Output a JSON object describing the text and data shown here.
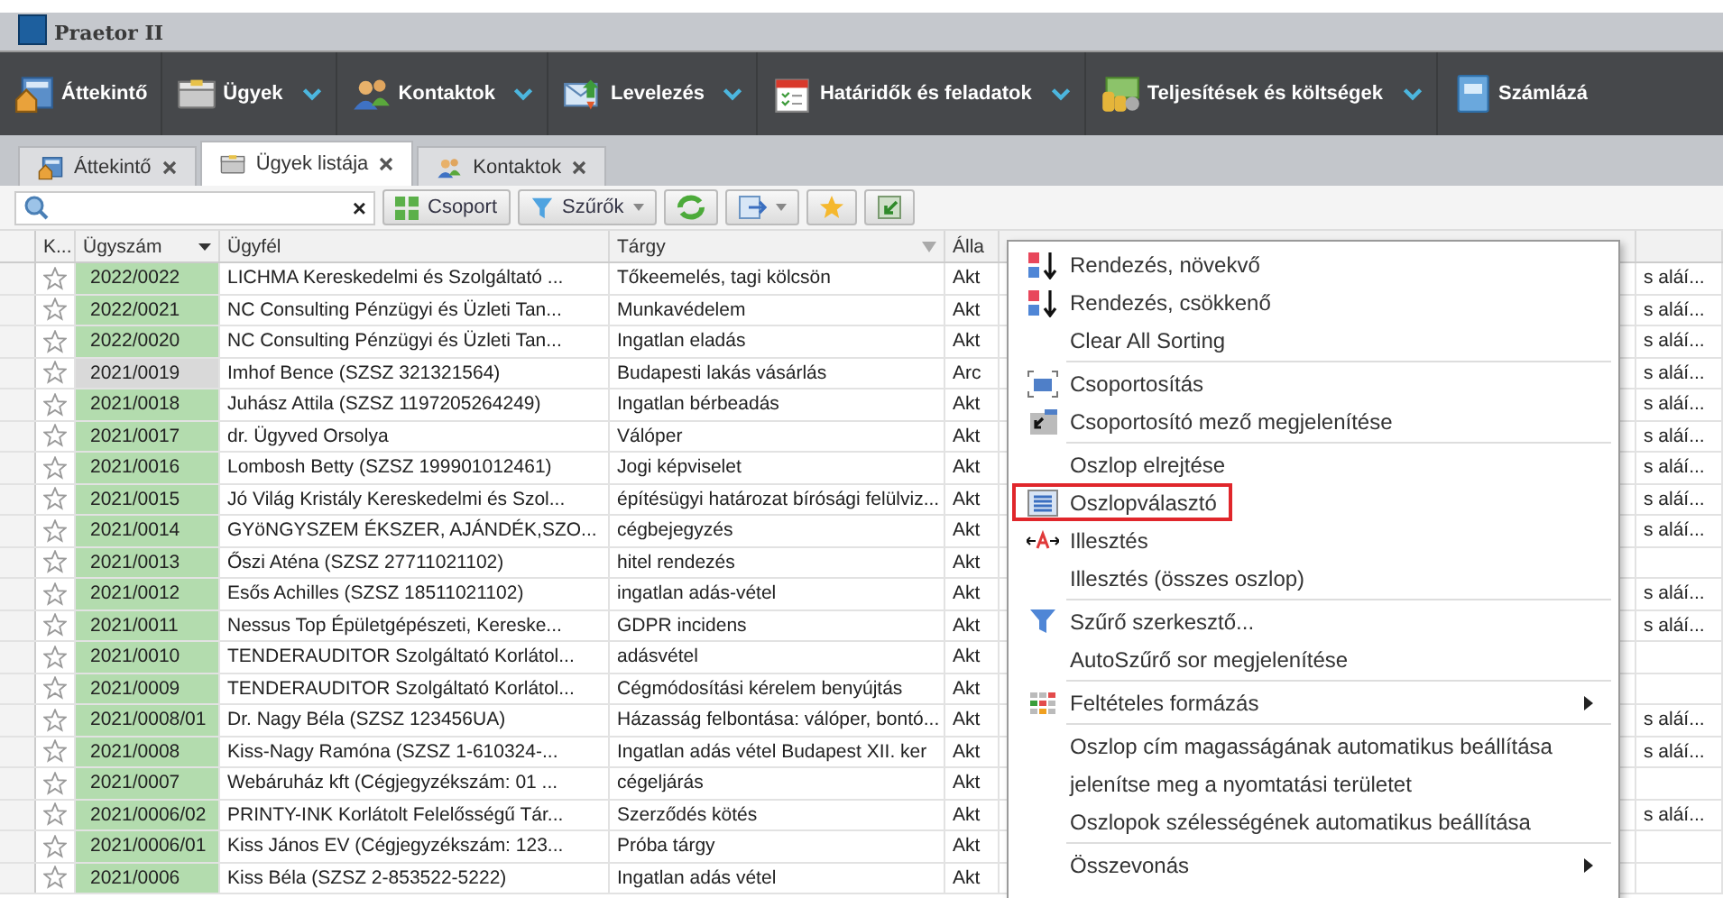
{
  "window": {
    "title": "Praetor II"
  },
  "nav": [
    {
      "label": "Áttekintő",
      "dropdown": false
    },
    {
      "label": "Ügyek",
      "dropdown": true
    },
    {
      "label": "Kontaktok",
      "dropdown": true
    },
    {
      "label": "Levelezés",
      "dropdown": true
    },
    {
      "label": "Határidők és feladatok",
      "dropdown": true
    },
    {
      "label": "Teljesítések és költségek",
      "dropdown": true
    },
    {
      "label": "Számlázá",
      "dropdown": false
    }
  ],
  "tabs": [
    {
      "label": "Áttekintő",
      "selected": false
    },
    {
      "label": "Ügyek listája",
      "selected": true
    },
    {
      "label": "Kontaktok",
      "selected": false
    }
  ],
  "toolbar": {
    "clear": "×",
    "group_button": "Csoport",
    "filter_button": "Szűrők"
  },
  "table": {
    "columns": [
      {
        "label": "K...",
        "sort": false,
        "filter": false
      },
      {
        "label": "Ügyszám",
        "sort": true,
        "filter": false
      },
      {
        "label": "Ügyfél",
        "sort": false,
        "filter": false
      },
      {
        "label": "Tárgy",
        "sort": false,
        "filter": true
      },
      {
        "label": "Álla",
        "sort": false,
        "filter": false
      }
    ],
    "rows": [
      {
        "starred": false,
        "color": "#b3dcae",
        "number": "2022/0022",
        "client": "LICHMA Kereskedelmi és Szolgáltató ...",
        "subject": "Tőkeemelés, tagi kölcsön",
        "status": "Akt",
        "column_6": "s aláí..."
      },
      {
        "starred": false,
        "color": "#b3dcae",
        "number": "2022/0021",
        "client": "NC Consulting Pénzügyi és Üzleti Tan...",
        "subject": "Munkavédelem",
        "status": "Akt",
        "column_6": "s aláí..."
      },
      {
        "starred": false,
        "color": "#b3dcae",
        "number": "2022/0020",
        "client": "NC Consulting Pénzügyi és Üzleti Tan...",
        "subject": "Ingatlan eladás",
        "status": "Akt",
        "column_6": "s aláí..."
      },
      {
        "starred": false,
        "color": "#d9d9d9",
        "number": "2021/0019",
        "client": "Imhof Bence (SZSZ 321321564)",
        "subject": "Budapesti lakás vásárlás",
        "status": "Arc",
        "column_6": "s aláí..."
      },
      {
        "starred": false,
        "color": "#b3dcae",
        "number": "2021/0018",
        "client": "Juhász  Attila (SZSZ 1197205264249)",
        "subject": "Ingatlan bérbeadás",
        "status": "Akt",
        "column_6": "s aláí..."
      },
      {
        "starred": false,
        "color": "#b3dcae",
        "number": "2021/0017",
        "client": "dr. Ügyved  Orsolya",
        "subject": "Válóper",
        "status": "Akt",
        "column_6": "s aláí..."
      },
      {
        "starred": false,
        "color": "#b3dcae",
        "number": "2021/0016",
        "client": "Lombosh Betty (SZSZ 199901012461)",
        "subject": "Jogi képviselet",
        "status": "Akt",
        "column_6": "s aláí..."
      },
      {
        "starred": false,
        "color": "#b3dcae",
        "number": "2021/0015",
        "client": "Jó Világ Kristály Kereskedelmi és Szol...",
        "subject": "építésügyi határozat bírósági felülviz...",
        "status": "Akt",
        "column_6": "s aláí..."
      },
      {
        "starred": false,
        "color": "#b3dcae",
        "number": "2021/0014",
        "client": "GYöNGYSZEM ÉKSZER, AJÁNDÉK,SZO...",
        "subject": "cégbejegyzés",
        "status": "Akt",
        "column_6": "s aláí..."
      },
      {
        "starred": false,
        "color": "#b3dcae",
        "number": "2021/0013",
        "client": "Őszi  Aténa (SZSZ 27711021102)",
        "subject": "hitel rendezés",
        "status": "Akt"
      },
      {
        "starred": false,
        "color": "#b3dcae",
        "number": "2021/0012",
        "client": "Esős Achilles (SZSZ 18511021102)",
        "subject": "ingatlan adás-vétel",
        "status": "Akt",
        "column_6": "s aláí..."
      },
      {
        "starred": false,
        "color": "#b3dcae",
        "number": "2021/0011",
        "client": "Nessus Top Épületgépészeti, Kereske...",
        "subject": "GDPR incidens",
        "status": "Akt",
        "column_6": "s aláí..."
      },
      {
        "starred": false,
        "color": "#b3dcae",
        "number": "2021/0010",
        "client": "TENDERAUDITOR Szolgáltató Korlátol...",
        "subject": "adásvétel",
        "status": "Akt"
      },
      {
        "starred": false,
        "color": "#b3dcae",
        "number": "2021/0009",
        "client": "TENDERAUDITOR Szolgáltató Korlátol...",
        "subject": "Cégmódosítási kérelem benyújtás",
        "status": "Akt"
      },
      {
        "starred": false,
        "color": "#b3dcae",
        "number": "2021/0008/01",
        "client": "Dr. Nagy Béla (SZSZ 123456UA)",
        "subject": "Házasság felbontása: válóper, bontó...",
        "status": "Akt",
        "column_6": "s aláí..."
      },
      {
        "starred": false,
        "color": "#b3dcae",
        "number": "2021/0008",
        "client": "Kiss-Nagy Ramóna (SZSZ 1-610324-...",
        "subject": "Ingatlan adás vétel Budapest XII. ker",
        "status": "Akt",
        "column_6": "s aláí..."
      },
      {
        "starred": false,
        "color": "#b3dcae",
        "number": "2021/0007",
        "client": "Webáruház kft (Cégjegyzékszám: 01 ...",
        "subject": "cégeljárás",
        "status": "Akt"
      },
      {
        "starred": false,
        "color": "#b3dcae",
        "number": "2021/0006/02",
        "client": "PRINTY-INK Korlátolt Felelősségű Tár...",
        "subject": "Szerződés kötés",
        "status": "Akt",
        "column_6": "s aláí..."
      },
      {
        "starred": false,
        "color": "#b3dcae",
        "number": "2021/0006/01",
        "client": "Kiss János EV (Cégjegyzékszám: 123...",
        "subject": "Próba tárgy",
        "status": "Akt"
      },
      {
        "starred": false,
        "color": "#b3dcae",
        "number": "2021/0006",
        "client": "Kiss Béla (SZSZ 2-853522-5222)",
        "subject": "Ingatlan adás vétel",
        "status": "Akt"
      }
    ]
  },
  "context_menu": {
    "groups": [
      [
        {
          "label": "Rendezés, növekvő",
          "highlighted": false,
          "submenu": false
        },
        {
          "label": "Rendezés, csökkenő",
          "highlighted": false,
          "submenu": false
        },
        {
          "label": "Clear All Sorting",
          "highlighted": false,
          "submenu": false
        }
      ],
      [
        {
          "label": "Csoportosítás",
          "highlighted": false,
          "submenu": false
        },
        {
          "label": "Csoportosító mező megjelenítése",
          "highlighted": false,
          "submenu": false
        }
      ],
      [
        {
          "label": "Oszlop elrejtése",
          "highlighted": false,
          "submenu": false
        },
        {
          "label": "Oszlopválasztó",
          "highlighted": true,
          "submenu": false
        },
        {
          "label": "Illesztés",
          "highlighted": false,
          "submenu": false
        },
        {
          "label": "Illesztés (összes oszlop)",
          "highlighted": false,
          "submenu": false
        }
      ],
      [
        {
          "label": "Szűrő szerkesztő...",
          "highlighted": false,
          "submenu": false
        },
        {
          "label": "AutoSzűrő sor megjelenítése",
          "highlighted": false,
          "submenu": false
        }
      ],
      [
        {
          "label": "Feltételes formázás",
          "highlighted": false,
          "submenu": true
        }
      ],
      [
        {
          "label": "Oszlop cím magasságának automatikus beállítása",
          "highlighted": false,
          "submenu": false
        },
        {
          "label": "jelenítse meg a nyomtatási területet",
          "highlighted": false,
          "submenu": false
        },
        {
          "label": "Oszlopok szélességének automatikus beállítása",
          "highlighted": false,
          "submenu": false
        }
      ],
      [
        {
          "label": "Összevonás",
          "highlighted": false,
          "submenu": true
        }
      ]
    ]
  }
}
